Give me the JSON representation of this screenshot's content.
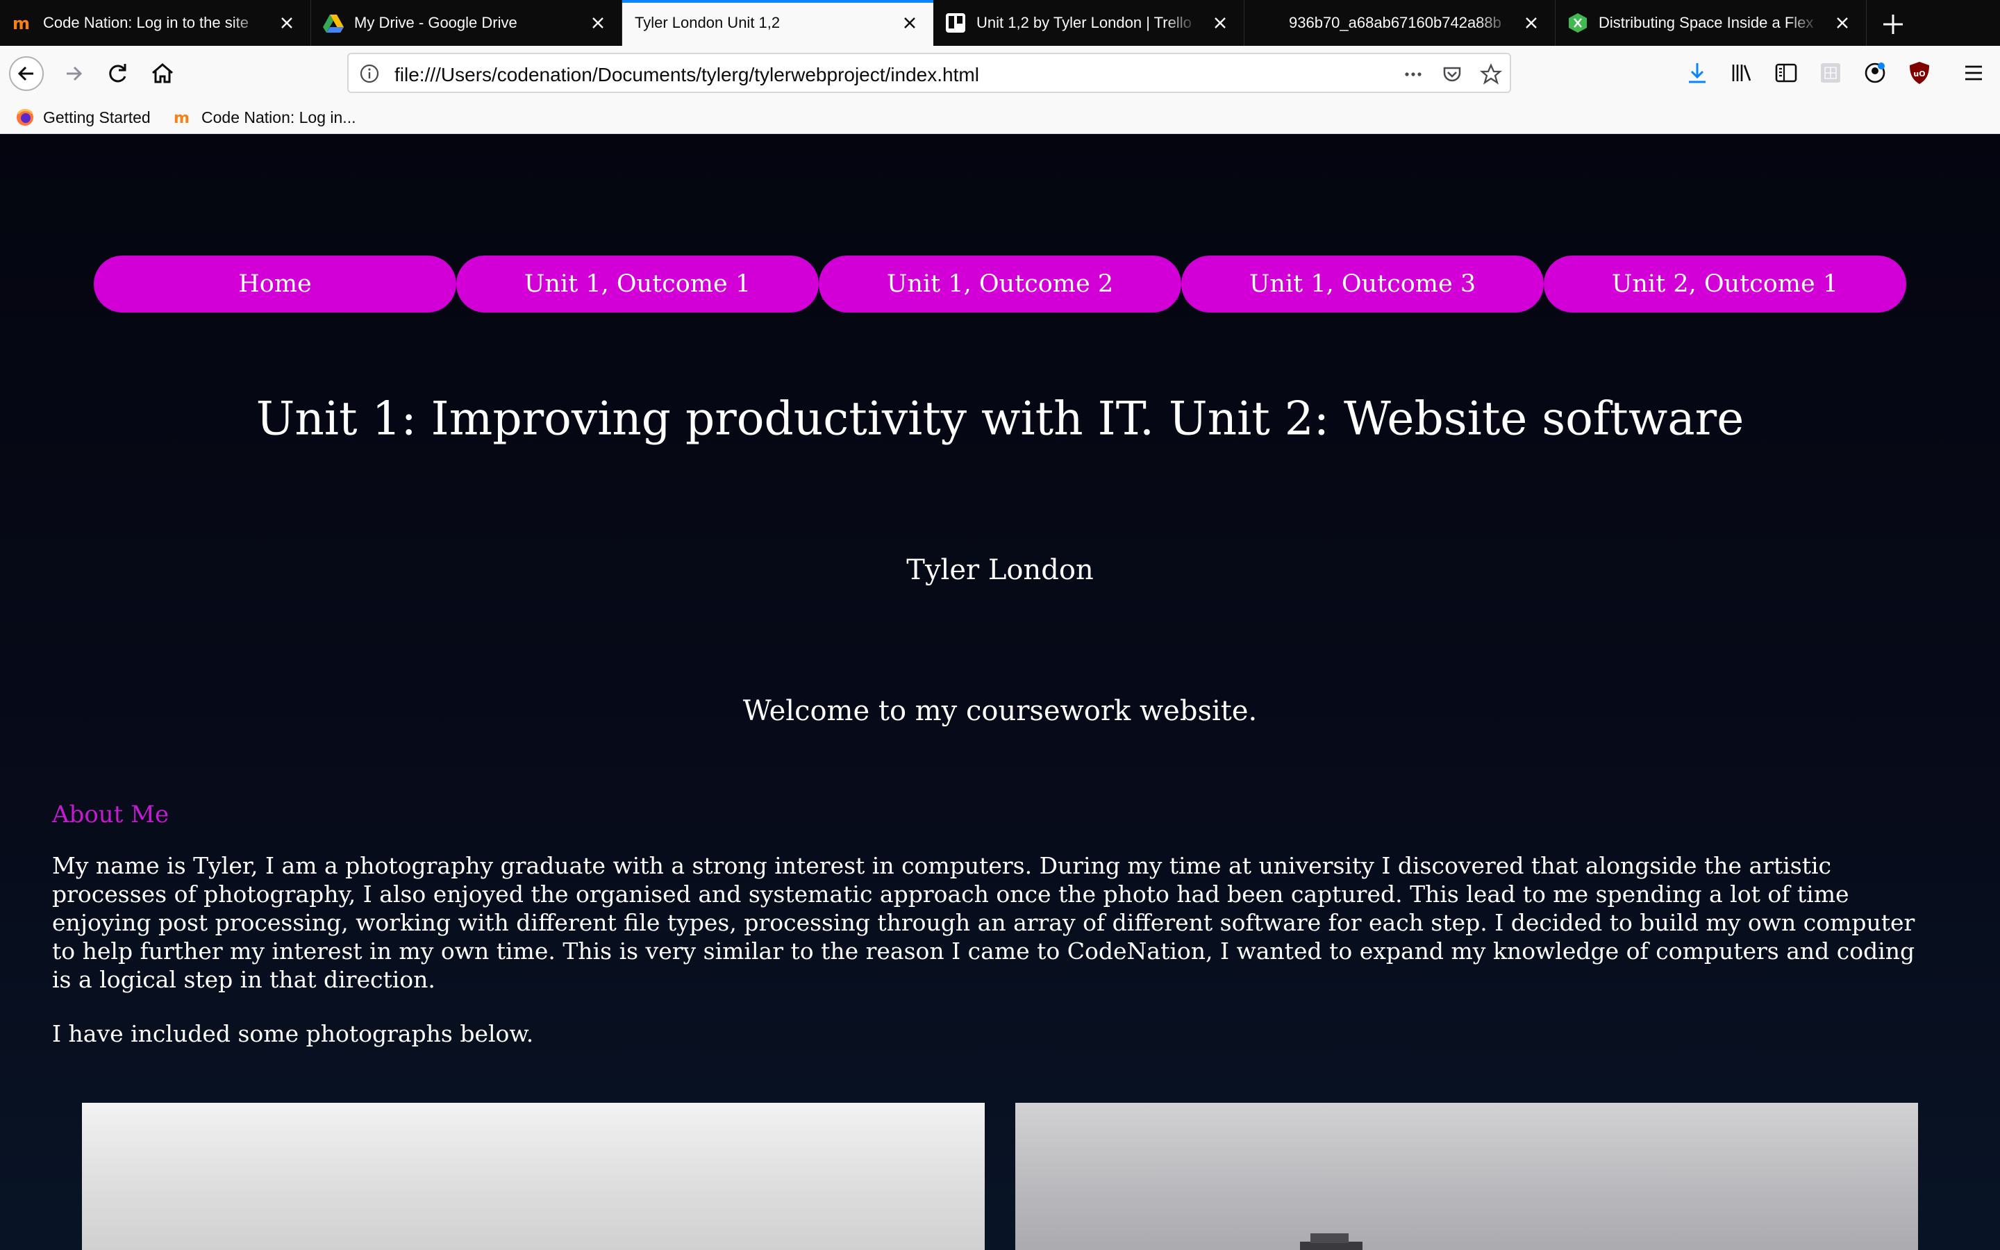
{
  "browser": {
    "tabs": [
      {
        "title": "Code Nation: Log in to the site",
        "icon": "code-nation-favicon"
      },
      {
        "title": "My Drive - Google Drive",
        "icon": "google-drive-favicon"
      },
      {
        "title": "Tyler London Unit 1,2",
        "icon": "",
        "active": true
      },
      {
        "title": "Unit 1,2 by Tyler London | Trello",
        "icon": "trello-favicon"
      },
      {
        "title": "936b70_a68ab67160b742a88b",
        "icon": ""
      },
      {
        "title": "Distributing Space Inside a Flex",
        "icon": "flex-favicon"
      }
    ],
    "url": "file:///Users/codenation/Documents/tylerg/tylerwebproject/index.html",
    "bookmarks": [
      {
        "label": "Getting Started",
        "icon": "firefox-icon"
      },
      {
        "label": "Code Nation: Log in...",
        "icon": "code-nation-favicon"
      }
    ],
    "colors": {
      "active_tab_accent": "#0a84ff",
      "chrome_dark": "#0c0c0d",
      "toolbar": "#f9f9fa"
    }
  },
  "page": {
    "nav": [
      "Home",
      "Unit 1, Outcome 1",
      "Unit 1, Outcome 2",
      "Unit 1, Outcome 3",
      "Unit 2, Outcome 1"
    ],
    "title": "Unit 1: Improving productivity with IT. Unit 2: Website software",
    "author": "Tyler London",
    "welcome": "Welcome to my coursework website.",
    "about_heading": "About Me",
    "about_text": "My name is Tyler, I am a photography graduate with a strong interest in computers. During my time at university I discovered that alongside the artistic processes of photography, I also enjoyed the organised and systematic approach once the photo had been captured. This lead to me spending a lot of time enjoying post processing, working with different file types, processing through an array of different software for each step. I decided to build my own computer to help further my interest in my own time. This is very similar to the reason I came to CodeNation, I wanted to expand my knowledge of computers and coding is a logical step in that direction.",
    "photos_note": "I have included some photographs below.",
    "colors": {
      "nav_pill": "#d200d6",
      "heading_accent": "#c51bd0",
      "background": "#060a14"
    }
  }
}
